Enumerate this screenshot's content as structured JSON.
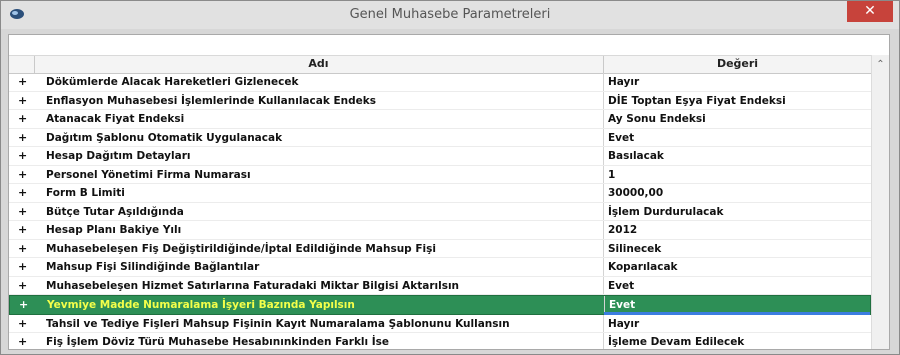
{
  "window": {
    "title": "Genel Muhasebe Parametreleri",
    "close_label": "✕"
  },
  "grid": {
    "headers": {
      "name": "Adı",
      "value": "Değeri"
    },
    "rows": [
      {
        "expand": "+",
        "name": "Dökümlerde Alacak Hareketleri Gizlenecek",
        "value": "Hayır"
      },
      {
        "expand": "+",
        "name": "Enflasyon Muhasebesi İşlemlerinde Kullanılacak Endeks",
        "value": "DİE Toptan Eşya Fiyat Endeksi"
      },
      {
        "expand": "+",
        "name": "Atanacak Fiyat Endeksi",
        "value": "Ay Sonu Endeksi"
      },
      {
        "expand": "+",
        "name": "Dağıtım Şablonu Otomatik Uygulanacak",
        "value": "Evet"
      },
      {
        "expand": "+",
        "name": "Hesap Dağıtım Detayları",
        "value": "Basılacak"
      },
      {
        "expand": "+",
        "name": "Personel Yönetimi Firma Numarası",
        "value": "1"
      },
      {
        "expand": "+",
        "name": "Form B Limiti",
        "value": "30000,00"
      },
      {
        "expand": "+",
        "name": "Bütçe Tutar Aşıldığında",
        "value": "İşlem Durdurulacak"
      },
      {
        "expand": "+",
        "name": "Hesap Planı Bakiye Yılı",
        "value": "2012"
      },
      {
        "expand": "+",
        "name": "Muhasebeleşen Fiş Değiştirildiğinde/İptal Edildiğinde Mahsup Fişi",
        "value": "Silinecek"
      },
      {
        "expand": "+",
        "name": "Mahsup Fişi Silindiğinde Bağlantılar",
        "value": "Koparılacak"
      },
      {
        "expand": "+",
        "name": "Muhasebeleşen Hizmet Satırlarına Faturadaki Miktar Bilgisi Aktarılsın",
        "value": "Evet"
      },
      {
        "expand": "+",
        "name": "Yevmiye Madde Numaralama İşyeri Bazında Yapılsın",
        "value": "Evet"
      },
      {
        "expand": "+",
        "name": "Tahsil ve Tediye Fişleri Mahsup Fişinin Kayıt Numaralama Şablonunu Kullansın",
        "value": "Hayır"
      },
      {
        "expand": "+",
        "name": "Fiş İşlem Döviz Türü Muhasebe Hesabınınkinden Farklı İse",
        "value": "İşleme Devam Edilecek"
      }
    ],
    "selected_index": 12
  },
  "colors": {
    "selected_bg": "#2d8f56",
    "selected_text": "#f4ff4a",
    "close_bg": "#c7433b"
  },
  "icons": {
    "app": "app-logo-icon",
    "close": "close-icon",
    "scroll_up": "chevron-up-icon"
  }
}
